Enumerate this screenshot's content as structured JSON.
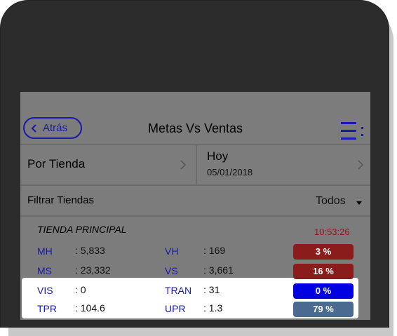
{
  "navbar": {
    "back_label": "Atrás",
    "title": "Metas Vs Ventas"
  },
  "selectors": {
    "store_label": "Por Tienda",
    "date_title": "Hoy",
    "date_value": "05/01/2018"
  },
  "filter": {
    "label": "Filtrar Tiendas",
    "value": "Todos"
  },
  "store": {
    "name": "TIENDA PRINCIPAL",
    "time": "10:53:26",
    "rows": [
      {
        "l1": "MH",
        "v1": ": 5,833",
        "l2": "VH",
        "v2": ": 169",
        "badge": "3 %",
        "badge_color": "#8b1c1c"
      },
      {
        "l1": "MS",
        "v1": ": 23,332",
        "l2": "VS",
        "v2": ": 3,661",
        "badge": "16 %",
        "badge_color": "#8b1c1c"
      },
      {
        "l1": "VIS",
        "v1": ": 0",
        "l2": "TRAN",
        "v2": ": 31",
        "badge": "0 %",
        "badge_color": "#0000e0"
      },
      {
        "l1": "TPR",
        "v1": ": 104.6",
        "l2": "UPR",
        "v2": ": 1.3",
        "badge": "79 %",
        "badge_color": "#4a6b8f"
      }
    ]
  },
  "colors": {
    "accent": "#1a1aa8",
    "overlay": "#7c7c7c",
    "time": "#8a1a1a"
  },
  "icons": {
    "back": "chevron-left-icon",
    "menu": "menu-list-icon",
    "chevron": "chevron-right-icon",
    "dropdown": "caret-down-icon"
  }
}
